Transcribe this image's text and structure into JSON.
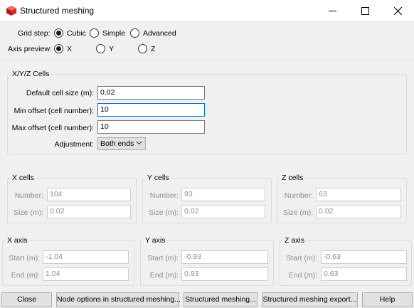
{
  "window": {
    "title": "Structured meshing",
    "icon": "cube-icon",
    "controls": [
      "minimize-icon",
      "maximize-icon",
      "close-icon"
    ]
  },
  "grid_step": {
    "label": "Grid step:",
    "options": [
      "Cubic",
      "Simple",
      "Advanced"
    ],
    "selected": "Cubic"
  },
  "axis_preview": {
    "label": "Axis preview:",
    "options": [
      "X",
      "Y",
      "Z"
    ],
    "selected": "X"
  },
  "cells_group": {
    "title": "X/Y/Z Cells",
    "default_cell_size": {
      "label": "Default cell size (m):",
      "value": "0.02"
    },
    "min_offset": {
      "label": "Min offset (cell number):",
      "value": "10"
    },
    "max_offset": {
      "label": "Max offset (cell number):",
      "value": "10"
    },
    "adjustment": {
      "label": "Adjustment:",
      "value": "Both ends"
    }
  },
  "x_cells": {
    "title": "X cells",
    "number_label": "Number:",
    "number": "104",
    "size_label": "Size (m):",
    "size": "0.02"
  },
  "y_cells": {
    "title": "Y cells",
    "number_label": "Number:",
    "number": "93",
    "size_label": "Size (m):",
    "size": "0.02"
  },
  "z_cells": {
    "title": "Z cells",
    "number_label": "Number:",
    "number": "63",
    "size_label": "Size (m):",
    "size": "0.02"
  },
  "x_axis": {
    "title": "X axis",
    "start_label": "Start (m):",
    "start": "-1.04",
    "end_label": "End (m):",
    "end": "1.04"
  },
  "y_axis": {
    "title": "Y axis",
    "start_label": "Start (m):",
    "start": "-0.93",
    "end_label": "End (m):",
    "end": "0.93"
  },
  "z_axis": {
    "title": "Z axis",
    "start_label": "Start (m):",
    "start": "-0.63",
    "end_label": "End (m):",
    "end": "0.63"
  },
  "buttons": {
    "close": "Close",
    "node_options": "Node options in structured meshing...",
    "structured_meshing": "Structured meshing...",
    "export": "Structured meshing export...",
    "help": "Help"
  },
  "colors": {
    "focus_border": "#0078d7",
    "disabled_text": "#8c8c8c",
    "icon_red": "#e2231a"
  }
}
